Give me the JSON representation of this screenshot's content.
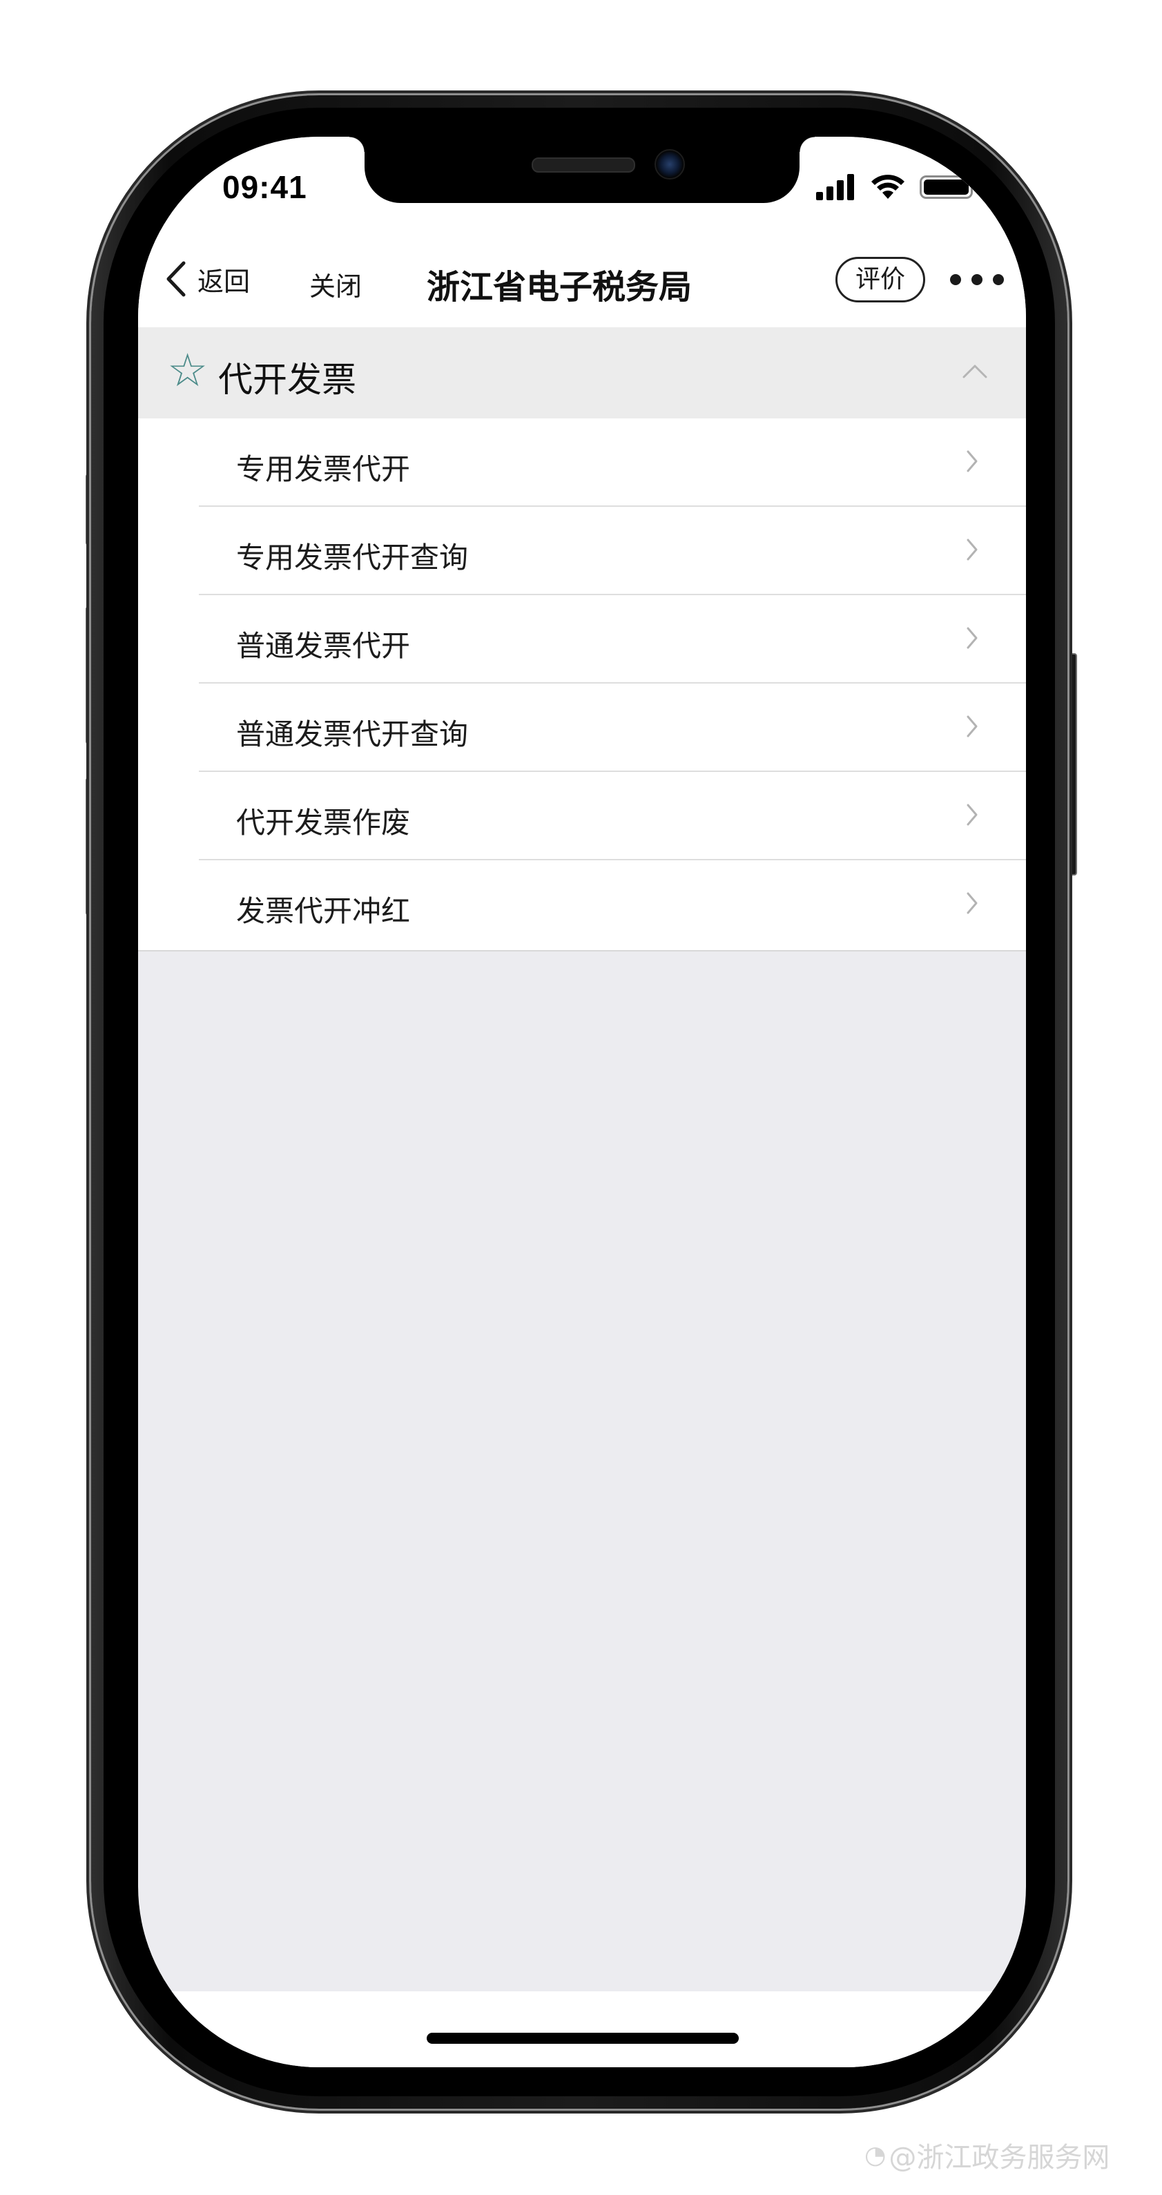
{
  "status_bar": {
    "time": "09:41",
    "icons": [
      "cellular-signal-icon",
      "wifi-icon",
      "battery-icon"
    ]
  },
  "nav": {
    "back_label": "返回",
    "close_label": "关闭",
    "title": "浙江省电子税务局",
    "rate_label": "评价",
    "more_icon": "more-dots-icon"
  },
  "section": {
    "star_glyph": "☆",
    "title": "代开发票",
    "expanded": true,
    "accent_color": "#4d8c8a"
  },
  "menu_items": [
    {
      "label": "专用发票代开"
    },
    {
      "label": "专用发票代开查询"
    },
    {
      "label": "普通发票代开"
    },
    {
      "label": "普通发票代开查询"
    },
    {
      "label": "代开发票作废"
    },
    {
      "label": "发票代开冲红"
    }
  ],
  "watermark": {
    "icon": "weibo-icon",
    "text": "@浙江政务服务网"
  },
  "colors": {
    "page_background": "#ececf0",
    "header_background": "#ececec",
    "list_background": "#ffffff"
  }
}
